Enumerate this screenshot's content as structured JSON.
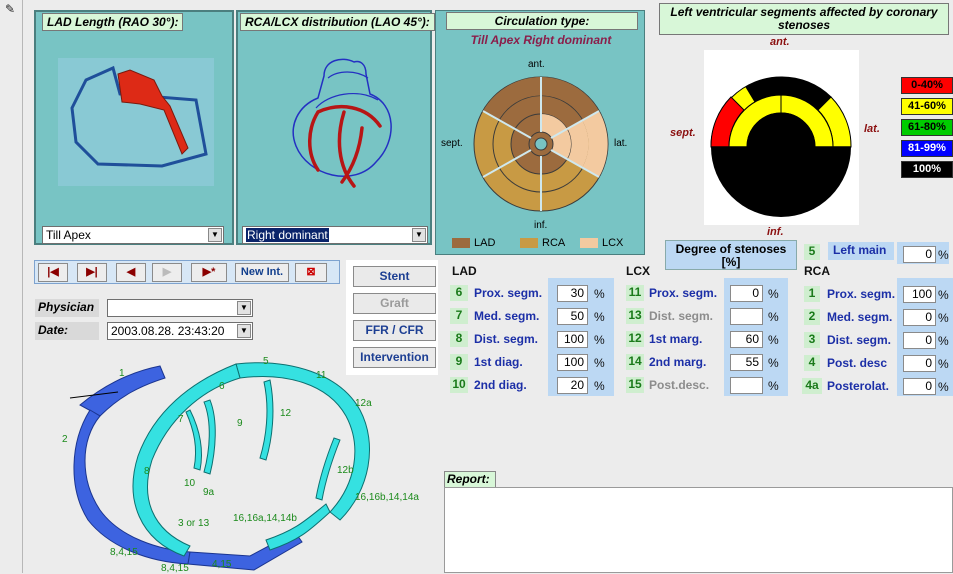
{
  "window": {
    "pencil_icon": "pencil-icon"
  },
  "lad_panel": {
    "title": "LAD Length (RAO 30°):",
    "combo_value": "Till Apex"
  },
  "rca_panel": {
    "title": "RCA/LCX distribution (LAO 45°):",
    "combo_value": "Right dominant"
  },
  "circ_panel": {
    "title": "Circulation type:",
    "subtitle": "Till Apex Right dominant",
    "labels": {
      "ant": "ant.",
      "sept": "sept.",
      "lat": "lat.",
      "inf": "inf."
    },
    "legend": [
      {
        "name": "LAD",
        "color": "#9c6b3e"
      },
      {
        "name": "RCA",
        "color": "#c89a44"
      },
      {
        "name": "LCX",
        "color": "#f3caa0"
      }
    ]
  },
  "lv_panel": {
    "title": "Left ventricular segments affected by coronary stenoses",
    "labels": {
      "ant": "ant.",
      "sept": "sept.",
      "lat": "lat.",
      "inf": "inf."
    },
    "legend": [
      {
        "label": "0-40%",
        "bg": "#ff0000",
        "fg": "#000000"
      },
      {
        "label": "41-60%",
        "bg": "#ffff00",
        "fg": "#000000"
      },
      {
        "label": "61-80%",
        "bg": "#00cc00",
        "fg": "#000000"
      },
      {
        "label": "81-99%",
        "bg": "#0000ff",
        "fg": "#ffffff"
      },
      {
        "label": "100%",
        "bg": "#000000",
        "fg": "#ffffff"
      }
    ]
  },
  "navbar": {
    "first_icon": "first-record-icon",
    "last_icon": "last-record-icon",
    "prev_icon": "previous-record-icon",
    "next_icon": "next-record-icon",
    "new_record_icon": "new-record-icon",
    "new_int_label": "New Int.",
    "delete_icon": "delete-record-icon"
  },
  "form": {
    "physician_label": "Physician",
    "physician_value": "",
    "date_label": "Date:",
    "date_value": "2003.08.28. 23:43:20"
  },
  "side_buttons": {
    "stent": "Stent",
    "graft": "Graft",
    "ffr": "FFR / CFR",
    "intervention": "Intervention"
  },
  "stenosis": {
    "header": "Degree of stenoses [%]",
    "left_main": {
      "num": "5",
      "label": "Left main",
      "value": "0"
    },
    "groups": [
      {
        "name": "LAD",
        "rows": [
          {
            "num": "6",
            "label": "Prox. segm.",
            "value": "30",
            "disabled": false
          },
          {
            "num": "7",
            "label": "Med. segm.",
            "value": "50",
            "disabled": false
          },
          {
            "num": "8",
            "label": "Dist. segm.",
            "value": "100",
            "disabled": false
          },
          {
            "num": "9",
            "label": "1st diag.",
            "value": "100",
            "disabled": false
          },
          {
            "num": "10",
            "label": "2nd diag.",
            "value": "20",
            "disabled": false
          }
        ]
      },
      {
        "name": "LCX",
        "rows": [
          {
            "num": "11",
            "label": "Prox. segm.",
            "value": "0",
            "disabled": false
          },
          {
            "num": "13",
            "label": "Dist. segm.",
            "value": "",
            "disabled": true
          },
          {
            "num": "12",
            "label": "1st marg.",
            "value": "60",
            "disabled": false
          },
          {
            "num": "14",
            "label": "2nd marg.",
            "value": "55",
            "disabled": false
          },
          {
            "num": "15",
            "label": "Post.desc.",
            "value": "",
            "disabled": true
          }
        ]
      },
      {
        "name": "RCA",
        "rows": [
          {
            "num": "1",
            "label": "Prox. segm.",
            "value": "100",
            "disabled": false
          },
          {
            "num": "2",
            "label": "Med. segm.",
            "value": "0",
            "disabled": false
          },
          {
            "num": "3",
            "label": "Dist. segm.",
            "value": "0",
            "disabled": false
          },
          {
            "num": "4",
            "label": "Post. desc",
            "value": "0",
            "disabled": false
          },
          {
            "num": "4a",
            "label": "Posterolat.",
            "value": "0",
            "disabled": false
          }
        ]
      }
    ],
    "percent_sign": "%"
  },
  "report": {
    "label": "Report:",
    "text": ""
  },
  "coronary_labels": [
    "1",
    "2",
    "5",
    "6",
    "7",
    "8",
    "9",
    "10",
    "11",
    "12",
    "12a",
    "12b",
    "9a",
    "3 or 13",
    "16,16a,14,14b",
    "16,16b,14,14a",
    "8,4,15",
    "8,4,15",
    "4,15"
  ]
}
